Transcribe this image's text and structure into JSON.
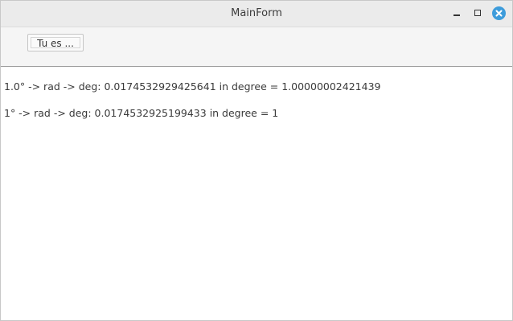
{
  "window": {
    "title": "MainForm"
  },
  "toolbar": {
    "button_label": "Tu es ..."
  },
  "content": {
    "line1": "1.0° -> rad -> deg: 0.0174532929425641 in degree = 1.00000002421439",
    "line2": "1° -> rad -> deg: 0.0174532925199433 in degree = 1"
  },
  "colors": {
    "close_button": "#3d9cdb"
  },
  "icons": [
    "minimize-icon",
    "maximize-icon",
    "close-icon"
  ]
}
